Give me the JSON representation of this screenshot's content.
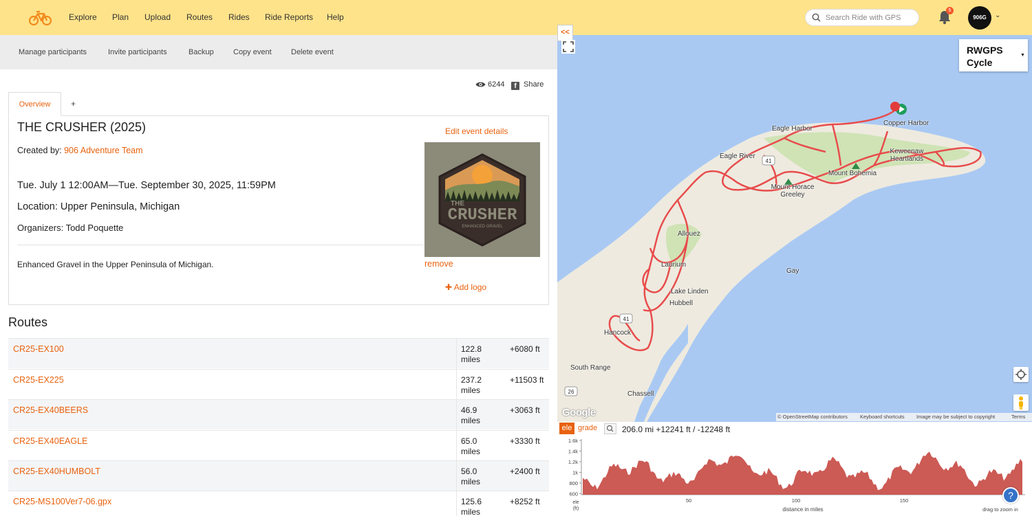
{
  "nav": {
    "links": [
      "Explore",
      "Plan",
      "Upload",
      "Routes",
      "Rides",
      "Ride Reports",
      "Help"
    ],
    "search_placeholder": "Search Ride with GPS",
    "notifications_count": "5",
    "avatar_text": "906G"
  },
  "toolbar": {
    "items": [
      "Manage participants",
      "Invite participants",
      "Backup",
      "Copy event",
      "Delete event"
    ]
  },
  "stats": {
    "views": "6244",
    "share_label": "Share"
  },
  "tabs": {
    "overview": "Overview",
    "add": "+"
  },
  "event": {
    "title": "THE CRUSHER (2025)",
    "created_by_label": "Created by:",
    "created_by": "906 Adventure Team",
    "dates": "Tue. July 1 12:00AM—Tue. September 30, 2025, 11:59PM",
    "location": "Location: Upper Peninsula, Michigan",
    "organizers": "Organizers: Todd Poquette",
    "description": "Enhanced Gravel in the Upper Peninsula of Michigan.",
    "edit_label": "Edit event details",
    "remove_label": "remove",
    "add_logo_label": "Add logo",
    "logo_text": "THE",
    "logo_text_big": "CRUSHER",
    "logo_subtext": "ENHANCED GRAVEL"
  },
  "routes": {
    "heading": "Routes",
    "rows": [
      {
        "name": "CR25-EX100",
        "distance": "122.8",
        "unit": "miles",
        "elevation": "+6080 ft"
      },
      {
        "name": "CR25-EX225",
        "distance": "237.2",
        "unit": "miles",
        "elevation": "+11503 ft"
      },
      {
        "name": "CR25-EX40BEERS",
        "distance": "46.9",
        "unit": "miles",
        "elevation": "+3063 ft"
      },
      {
        "name": "CR25-EX40EAGLE",
        "distance": "65.0",
        "unit": "miles",
        "elevation": "+3330 ft"
      },
      {
        "name": "CR25-EX40HUMBOLT",
        "distance": "56.0",
        "unit": "miles",
        "elevation": "+2400 ft"
      },
      {
        "name": "CR25-MS100Ver7-06.gpx",
        "distance": "125.6",
        "unit": "miles",
        "elevation": "+8252 ft"
      }
    ]
  },
  "map": {
    "collapse_label": "<<",
    "map_type": "RWGPS Cycle",
    "labels": [
      "Copper Harbor",
      "Eagle Harbor",
      "Eagle River",
      "Keweenaw Heartlands",
      "Mount Bohemia",
      "Mount Horace Greeley",
      "Allouez",
      "Laurium",
      "Gay",
      "Lake Linden",
      "Hubbell",
      "Hancock",
      "South Range",
      "Chassell"
    ],
    "road_shields": [
      "41",
      "41",
      "26"
    ],
    "attribution": [
      "© OpenStreetMap contributors",
      "Keyboard shortcuts",
      "Image may be subject to copyright",
      "Terms"
    ],
    "google_label": "Google",
    "route_color": "#e84c4c",
    "water_color": "#a9c9f3",
    "land_color": "#eeeadf"
  },
  "elevation": {
    "ele_label": "ele",
    "grade_label": "grade",
    "summary": "206.0 mi +12241 ft / -12248 ft",
    "y_ticks": [
      "1.6k",
      "1.4k",
      "1.2k",
      "1k",
      "800",
      "600"
    ],
    "x_ticks": [
      "50",
      "100",
      "150"
    ],
    "y_label": "ele",
    "y_unit": "(ft)",
    "x_label": "distance in miles",
    "hint": "drag to zoom in",
    "fill_color": "#cc5a55"
  }
}
